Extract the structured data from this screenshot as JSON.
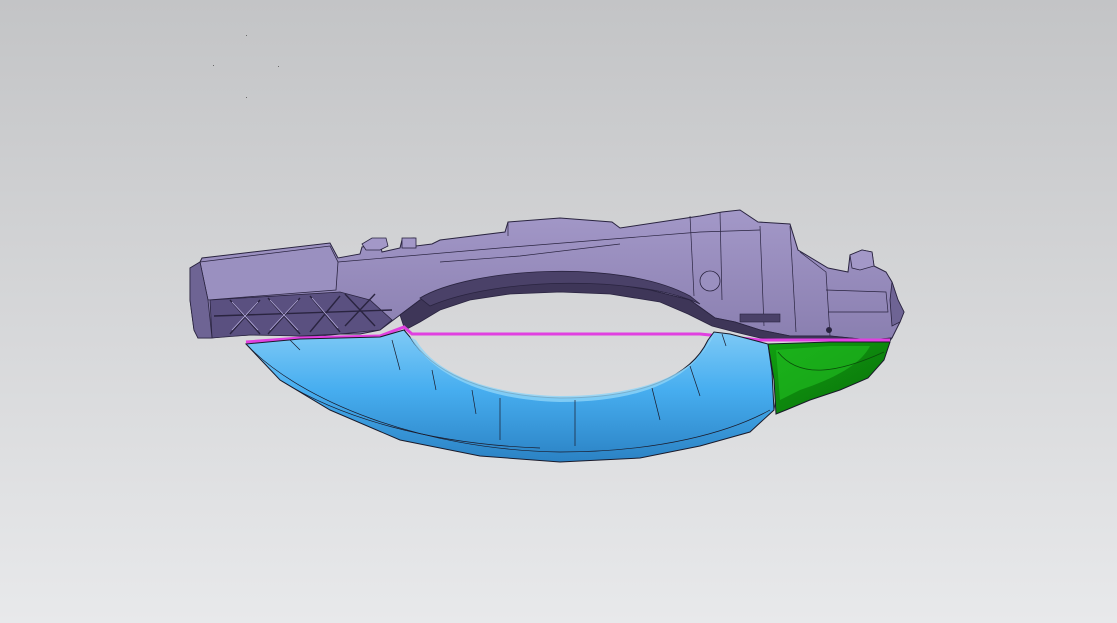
{
  "viewport": {
    "background_top": "#c3c4c6",
    "background_bottom": "#e8e9eb"
  },
  "model": {
    "colors": {
      "housing": "#8a7fb0",
      "housing_light": "#a398c8",
      "housing_dark": "#3e3658",
      "housing_edge": "#2a2440",
      "handle": "#47aef0",
      "handle_light": "#7fcaf6",
      "handle_dark": "#2b82c4",
      "end_cap": "#10a010",
      "end_cap_dark": "#0a6e0a",
      "seam": "#e040e0",
      "edge_line": "#1a1a2a"
    }
  }
}
